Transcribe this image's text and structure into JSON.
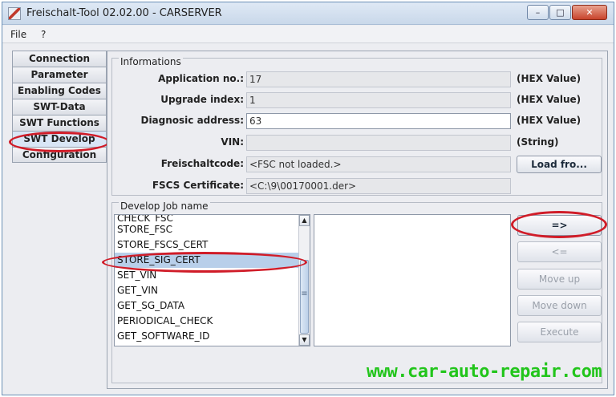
{
  "window": {
    "title": "Freischalt-Tool 02.02.00 - CARSERVER",
    "controls": {
      "minimize": "–",
      "maximize": "□",
      "close": "✕"
    }
  },
  "menu": {
    "file": "File",
    "help": "?"
  },
  "tabs": [
    "Connection",
    "Parameter",
    "Enabling Codes",
    "SWT-Data",
    "SWT Functions",
    "SWT Develop",
    "Configuration"
  ],
  "informations": {
    "title": "Informations",
    "application_no": {
      "label": "Application no.:",
      "value": "17",
      "unit": "(HEX Value)"
    },
    "upgrade_index": {
      "label": "Upgrade index:",
      "value": "1",
      "unit": "(HEX Value)"
    },
    "diagnostic_address": {
      "label": "Diagnosic address:",
      "value": "63",
      "unit": "(HEX Value)"
    },
    "vin": {
      "label": "VIN:",
      "value": "",
      "unit": "(String)"
    },
    "freischaltcode": {
      "label": "Freischaltcode:",
      "value": "<FSC not loaded.>",
      "button": "Load fro..."
    },
    "fscs_certificate": {
      "label": "FSCS Certificate:",
      "value": "<C:\\9\\00170001.der>"
    }
  },
  "develop": {
    "title": "Develop Job name",
    "jobs": [
      "CHECK_FSC",
      "STORE_FSC",
      "STORE_FSCS_CERT",
      "STORE_SIG_CERT",
      "SET_VIN",
      "GET_VIN",
      "GET_SG_DATA",
      "PERIODICAL_CHECK",
      "GET_SOFTWARE_ID"
    ],
    "selected_job": "STORE_SIG_CERT",
    "scroll_up": "▲",
    "scroll_down": "▼",
    "scroll_grip": "≡"
  },
  "buttons": {
    "add": "=>",
    "remove": "<=",
    "move_up": "Move up",
    "move_down": "Move down",
    "execute": "Execute"
  },
  "watermark": "www.car-auto-repair.com"
}
